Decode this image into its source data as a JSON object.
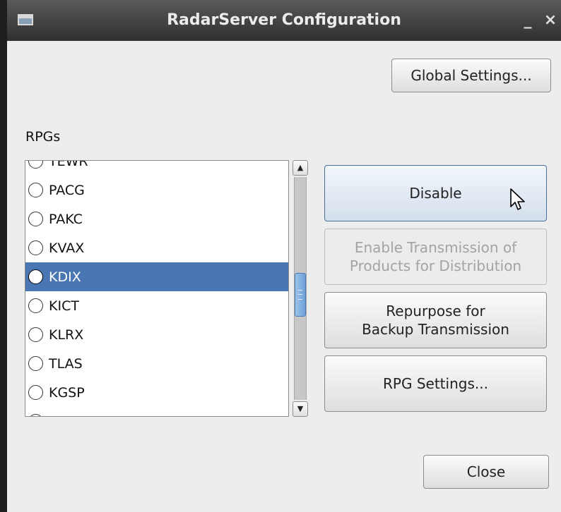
{
  "window": {
    "title": "RadarServer Configuration",
    "minimize_glyph": "_",
    "close_glyph": "×"
  },
  "buttons": {
    "global_settings": "Global Settings...",
    "disable": "Disable",
    "enable_transmission_line1": "Enable Transmission of",
    "enable_transmission_line2": "Products for Distribution",
    "repurpose_line1": "Repurpose for",
    "repurpose_line2": "Backup Transmission",
    "rpg_settings": "RPG Settings...",
    "close": "Close"
  },
  "rpgs": {
    "label": "RPGs",
    "selected": "KDIX",
    "items": [
      {
        "label": "TEWR"
      },
      {
        "label": "PACG"
      },
      {
        "label": "PAKC"
      },
      {
        "label": "KVAX"
      },
      {
        "label": "KDIX"
      },
      {
        "label": "KICT"
      },
      {
        "label": "KLRX"
      },
      {
        "label": "TLAS"
      },
      {
        "label": "KGSP"
      },
      {
        "label": ""
      }
    ]
  },
  "scrollbar": {
    "up_glyph": "▲",
    "down_glyph": "▼"
  },
  "colors": {
    "selection": "#4a76b4",
    "titlebar": "#3a3a3a",
    "window_bg": "#ededed"
  }
}
